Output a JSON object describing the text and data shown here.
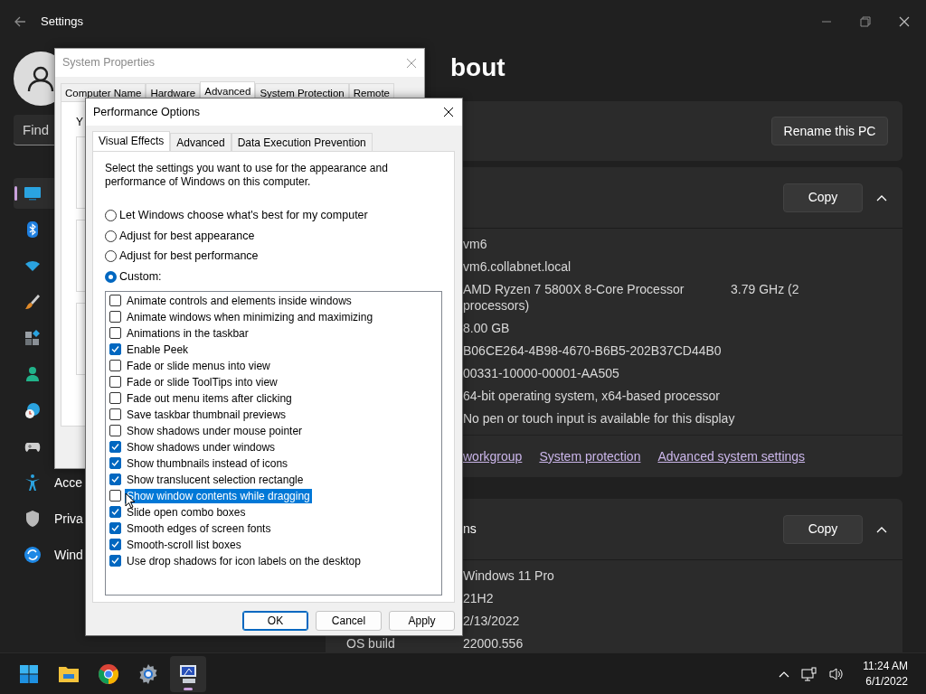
{
  "settings": {
    "title": "Settings",
    "page_title": "bout",
    "search": {
      "placeholder": "Find"
    },
    "nav": [
      {
        "kind": "display",
        "selected": true
      },
      {
        "kind": "bluetooth",
        "selected": false
      },
      {
        "kind": "network",
        "selected": false
      },
      {
        "kind": "personalization",
        "selected": false
      },
      {
        "kind": "apps",
        "selected": false
      },
      {
        "kind": "accounts",
        "selected": false
      },
      {
        "kind": "time",
        "selected": false
      },
      {
        "kind": "gaming",
        "selected": false
      },
      {
        "kind": "accessibility",
        "label": "Acce",
        "selected": false
      },
      {
        "kind": "privacy",
        "label": "Priva",
        "selected": false
      },
      {
        "kind": "update",
        "label": "Wind",
        "selected": false
      }
    ],
    "device_card": {
      "button": "Rename this PC"
    },
    "specs_card": {
      "button": "Copy",
      "expanded": true,
      "rows": [
        {
          "value": "vm6"
        },
        {
          "value": "vm6.collabnet.local"
        },
        {
          "value": "AMD Ryzen 7 5800X 8-Core Processor",
          "detail": "3.79 GHz  (2",
          "continuation": "processors)"
        },
        {
          "value": "8.00 GB"
        },
        {
          "value": "B06CE264-4B98-4670-B6B5-202B37CD44B0"
        },
        {
          "value": "00331-10000-00001-AA505"
        },
        {
          "value": "64-bit operating system, x64-based processor"
        },
        {
          "value": "No pen or touch input is available for this display"
        }
      ]
    },
    "related_links": [
      "workgroup",
      "System protection",
      "Advanced system settings"
    ],
    "windows_card": {
      "heading": "ns",
      "button": "Copy",
      "expanded": true,
      "rows": [
        {
          "value": "Windows 11 Pro"
        },
        {
          "value": "21H2"
        },
        {
          "value": "2/13/2022"
        },
        {
          "label": "OS build",
          "value": "22000.556"
        }
      ]
    }
  },
  "system_properties": {
    "title": "System Properties",
    "active": false,
    "tabs": [
      {
        "label": "Computer Name",
        "selected": false
      },
      {
        "label": "Hardware",
        "selected": false
      },
      {
        "label": "Advanced",
        "selected": true
      },
      {
        "label": "System Protection",
        "selected": false
      },
      {
        "label": "Remote",
        "selected": false
      }
    ],
    "intro": "Y"
  },
  "performance_options": {
    "title": "Performance Options",
    "tabs": [
      {
        "label": "Visual Effects",
        "selected": true
      },
      {
        "label": "Advanced",
        "selected": false
      },
      {
        "label": "Data Execution Prevention",
        "selected": false
      }
    ],
    "description": "Select the settings you want to use for the appearance and performance of Windows on this computer.",
    "radios": [
      {
        "label": "Let Windows choose what's best for my computer",
        "selected": false
      },
      {
        "label": "Adjust for best appearance",
        "selected": false
      },
      {
        "label": "Adjust for best performance",
        "selected": false
      },
      {
        "label": "Custom:",
        "selected": true
      }
    ],
    "effects": [
      {
        "label": "Animate controls and elements inside windows",
        "checked": false,
        "selected": false
      },
      {
        "label": "Animate windows when minimizing and maximizing",
        "checked": false,
        "selected": false
      },
      {
        "label": "Animations in the taskbar",
        "checked": false,
        "selected": false
      },
      {
        "label": "Enable Peek",
        "checked": true,
        "selected": false
      },
      {
        "label": "Fade or slide menus into view",
        "checked": false,
        "selected": false
      },
      {
        "label": "Fade or slide ToolTips into view",
        "checked": false,
        "selected": false
      },
      {
        "label": "Fade out menu items after clicking",
        "checked": false,
        "selected": false
      },
      {
        "label": "Save taskbar thumbnail previews",
        "checked": false,
        "selected": false
      },
      {
        "label": "Show shadows under mouse pointer",
        "checked": false,
        "selected": false
      },
      {
        "label": "Show shadows under windows",
        "checked": true,
        "selected": false
      },
      {
        "label": "Show thumbnails instead of icons",
        "checked": true,
        "selected": false
      },
      {
        "label": "Show translucent selection rectangle",
        "checked": true,
        "selected": false
      },
      {
        "label": "Show window contents while dragging",
        "checked": false,
        "selected": true
      },
      {
        "label": "Slide open combo boxes",
        "checked": true,
        "selected": false
      },
      {
        "label": "Smooth edges of screen fonts",
        "checked": true,
        "selected": false
      },
      {
        "label": "Smooth-scroll list boxes",
        "checked": true,
        "selected": false
      },
      {
        "label": "Use drop shadows for icon labels on the desktop",
        "checked": true,
        "selected": false
      }
    ],
    "buttons": [
      {
        "label": "OK",
        "default": true
      },
      {
        "label": "Cancel",
        "default": false
      },
      {
        "label": "Apply",
        "default": false
      }
    ]
  },
  "taskbar": {
    "apps": [
      {
        "kind": "start",
        "active": false
      },
      {
        "kind": "explorer",
        "active": false
      },
      {
        "kind": "browser",
        "active": false
      },
      {
        "kind": "settings",
        "active": false
      },
      {
        "kind": "sysprops",
        "active": true
      }
    ],
    "clock": {
      "time": "11:24 AM",
      "date": "6/1/2022"
    }
  }
}
